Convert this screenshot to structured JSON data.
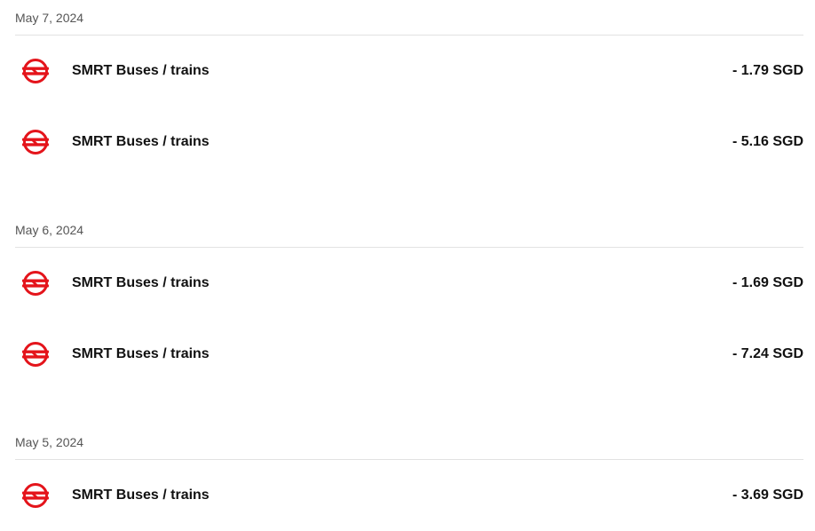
{
  "groups": [
    {
      "date": "May 7, 2024",
      "transactions": [
        {
          "merchant": "SMRT Buses / trains",
          "amount": "- 1.79 SGD",
          "icon": "smrt-logo-icon"
        },
        {
          "merchant": "SMRT Buses / trains",
          "amount": "- 5.16 SGD",
          "icon": "smrt-logo-icon"
        }
      ]
    },
    {
      "date": "May 6, 2024",
      "transactions": [
        {
          "merchant": "SMRT Buses / trains",
          "amount": "- 1.69 SGD",
          "icon": "smrt-logo-icon"
        },
        {
          "merchant": "SMRT Buses / trains",
          "amount": "- 7.24 SGD",
          "icon": "smrt-logo-icon"
        }
      ]
    },
    {
      "date": "May 5, 2024",
      "transactions": [
        {
          "merchant": "SMRT Buses / trains",
          "amount": "- 3.69 SGD",
          "icon": "smrt-logo-icon"
        }
      ]
    }
  ],
  "colors": {
    "logo_red": "#e4141b",
    "divider": "#e2e2e2",
    "date_text": "#555555",
    "primary_text": "#111111"
  }
}
